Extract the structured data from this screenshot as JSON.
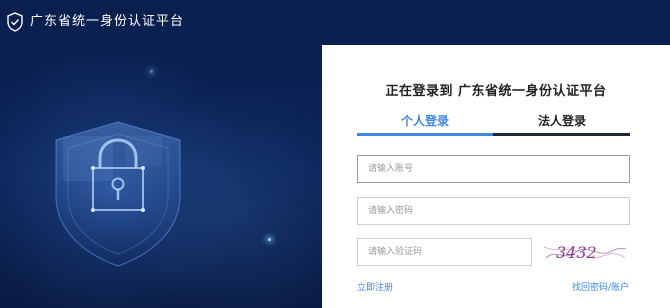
{
  "header": {
    "title": "广东省统一身份认证平台",
    "logo_icon": "shield-check-icon"
  },
  "panel": {
    "title": "正在登录到 广东省统一身份认证平台",
    "tabs": [
      {
        "label": "个人登录",
        "active": true
      },
      {
        "label": "法人登录",
        "active": false
      }
    ],
    "account": {
      "placeholder": "请输入账号",
      "value": ""
    },
    "password": {
      "placeholder": "请输入密码",
      "value": ""
    },
    "captcha": {
      "placeholder": "请输入验证码",
      "value": "",
      "image_text": "3432"
    },
    "register_link": "立即注册",
    "recover_link": "找回密码/账户"
  },
  "colors": {
    "background": "#0b1f4a",
    "accent": "#3e86e0",
    "captcha_text": "#8a3e8c"
  },
  "illustration": {
    "icon": "shield-lock-icon"
  }
}
